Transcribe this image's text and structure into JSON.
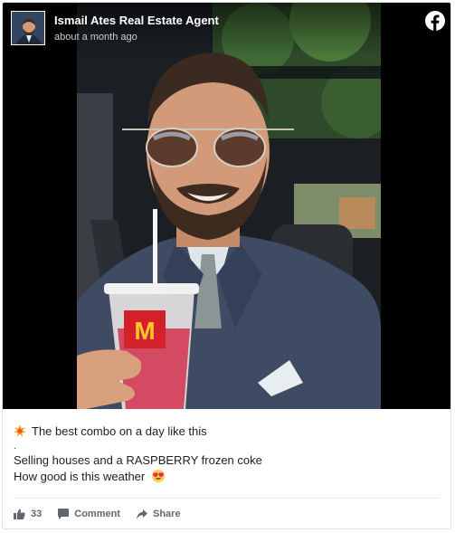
{
  "post": {
    "page_name": "Ismail Ates Real Estate Agent",
    "timestamp": "about a month ago",
    "text": {
      "line1": "The best combo on a day like this",
      "dot": ".",
      "line2": "Selling houses and a RASPBERRY frozen coke",
      "line3": "How good is this weather"
    },
    "actions": {
      "likes_count": "33",
      "comment_label": "Comment",
      "share_label": "Share"
    }
  },
  "icons": {
    "brand": "facebook-icon",
    "like": "thumbs-up-icon",
    "comment": "comment-icon",
    "share": "share-icon",
    "emoji_spark": "collision-emoji",
    "emoji_love": "heart-eyes-emoji"
  },
  "colors": {
    "text": "#1c1e21",
    "muted": "#606770",
    "border": "#dddfe2",
    "media_bg": "#000000"
  }
}
